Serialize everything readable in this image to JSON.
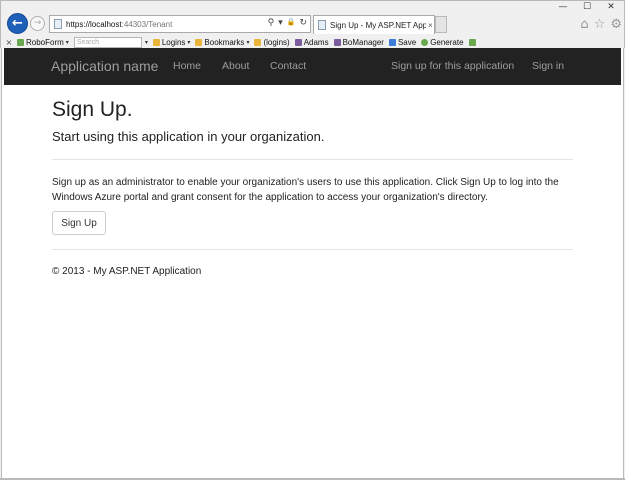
{
  "browser": {
    "caption": {
      "minimize": "—",
      "maximize": "☐",
      "close": "✕"
    },
    "back_glyph": "←",
    "forward_glyph": "→",
    "address": {
      "host": "https://localhost",
      "rest": ":44303/Tenant",
      "search_glyph": "⚲",
      "dropdown_glyph": "▾",
      "lock_glyph": "🔒",
      "refresh_glyph": "↻"
    },
    "tab": {
      "title": "Sign Up - My ASP.NET Appl...",
      "close": "×"
    },
    "right_icons": {
      "home": "⌂",
      "favorites": "☆",
      "tools": "⚙"
    },
    "favorites_bar": {
      "close": "×",
      "roboform": "RoboForm",
      "search_placeholder": "Search",
      "logins": "Logins",
      "bookmarks": "Bookmarks",
      "logins_folder": "(logins)",
      "adams": "Adams",
      "bomanager": "BoManager",
      "save": "Save",
      "generate": "Generate",
      "caret": "▾"
    }
  },
  "page": {
    "navbar": {
      "brand": "Application name",
      "links": [
        "Home",
        "About",
        "Contact"
      ],
      "signup_link": "Sign up for this application",
      "signin_link": "Sign in"
    },
    "title": "Sign Up.",
    "lead": "Start using this application in your organization.",
    "description": "Sign up as an administrator to enable your organization's users to use this application. Click Sign Up to log into the Windows Azure portal and grant consent for the application to access your organization's directory.",
    "signup_button": "Sign Up",
    "footer": "© 2013 - My ASP.NET Application"
  },
  "colors": {
    "navbar_bg": "#222222",
    "navbar_text": "#9d9d9d",
    "back_button": "#1e5fb8"
  }
}
